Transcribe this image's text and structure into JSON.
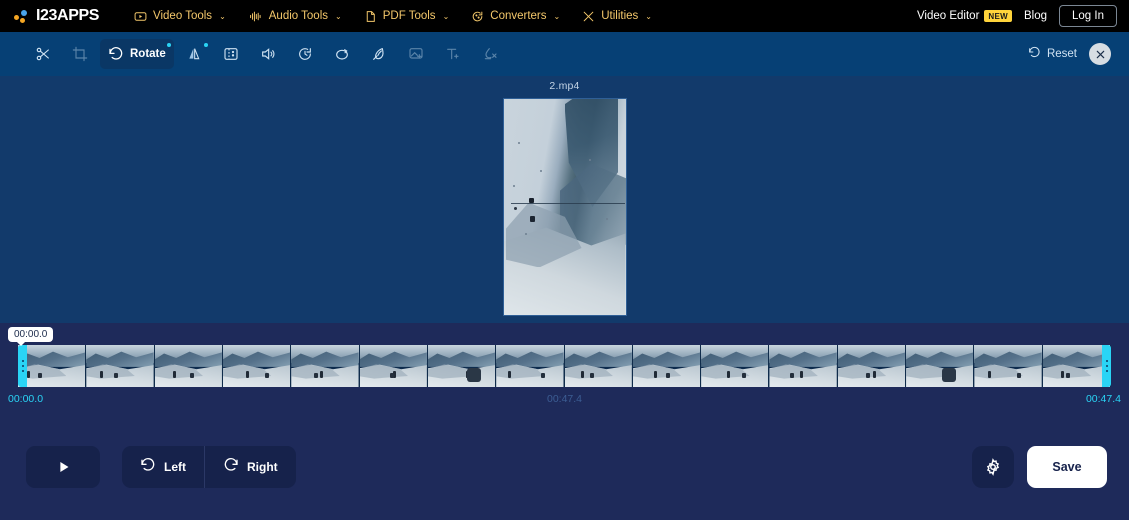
{
  "nav": {
    "logo_text": "I23APPS",
    "items": [
      {
        "label": "Video Tools",
        "icon": "video-play-icon"
      },
      {
        "label": "Audio Tools",
        "icon": "audio-waveform-icon"
      },
      {
        "label": "PDF Tools",
        "icon": "document-icon"
      },
      {
        "label": "Converters",
        "icon": "convert-arrows-icon"
      },
      {
        "label": "Utilities",
        "icon": "tools-cross-icon"
      }
    ],
    "caret": "⌄",
    "video_editor_label": "Video Editor",
    "new_badge": "NEW",
    "blog_label": "Blog",
    "login_label": "Log In"
  },
  "toolbar": {
    "tools": [
      {
        "name": "cut",
        "label": "",
        "icon": "scissors-icon",
        "active": false,
        "dim": false,
        "dot": false
      },
      {
        "name": "crop",
        "label": "",
        "icon": "crop-icon",
        "active": false,
        "dim": true,
        "dot": false
      },
      {
        "name": "rotate",
        "label": "Rotate",
        "icon": "rotate-ccw-icon",
        "active": true,
        "dim": false,
        "dot": true
      },
      {
        "name": "flip",
        "label": "",
        "icon": "flip-horizontal-icon",
        "active": false,
        "dim": false,
        "dot": true
      },
      {
        "name": "canvas",
        "label": "",
        "icon": "canvas-frame-icon",
        "active": false,
        "dim": false,
        "dot": false
      },
      {
        "name": "volume",
        "label": "",
        "icon": "speaker-icon",
        "active": false,
        "dim": false,
        "dot": false
      },
      {
        "name": "speed",
        "label": "",
        "icon": "speedometer-icon",
        "active": false,
        "dim": false,
        "dot": false
      },
      {
        "name": "loop",
        "label": "",
        "icon": "loop-arrow-icon",
        "active": false,
        "dim": false,
        "dot": false
      },
      {
        "name": "effects",
        "label": "",
        "icon": "magic-wand-icon",
        "active": false,
        "dim": false,
        "dot": false
      },
      {
        "name": "add-image",
        "label": "",
        "icon": "add-image-icon",
        "active": false,
        "dim": true,
        "dot": false
      },
      {
        "name": "add-text",
        "label": "",
        "icon": "add-text-icon",
        "active": false,
        "dim": true,
        "dot": false
      },
      {
        "name": "remove-watermark",
        "label": "",
        "icon": "remove-watermark-icon",
        "active": false,
        "dim": true,
        "dot": false
      }
    ],
    "reset_label": "Reset",
    "close_label": "✕"
  },
  "canvas": {
    "file_name": "2.mp4"
  },
  "timeline": {
    "playhead_time": "00:00.0",
    "start_time": "00:00.0",
    "mid_time": "00:47.4",
    "end_time": "00:47.4",
    "thumbnail_count": 16
  },
  "bottom": {
    "play_label": "▶",
    "left_label": "Left",
    "right_label": "Right",
    "settings_icon": "gear-icon",
    "save_label": "Save"
  },
  "colors": {
    "nav_bg": "#000000",
    "toolbar_bg": "#064075",
    "canvas_bg": "#123a6b",
    "panel_bg": "#1e2a5a",
    "accent_cyan": "#2ad4f5",
    "accent_yellow": "#ffd43b",
    "nav_link": "#f4c86b"
  }
}
